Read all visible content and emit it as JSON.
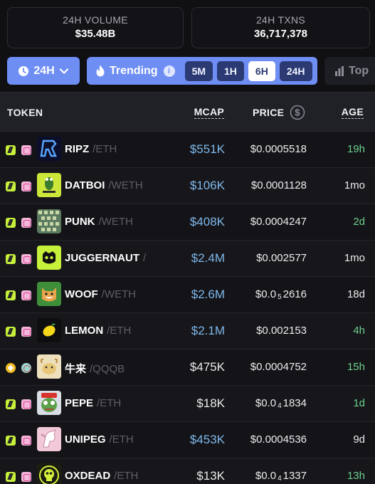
{
  "stats": {
    "volume": {
      "label": "24H VOLUME",
      "value": "$35.48B"
    },
    "txns": {
      "label": "24H TXNS",
      "value": "36,717,378"
    }
  },
  "filters": {
    "period": "24H",
    "trending_label": "Trending",
    "timeframes": [
      {
        "label": "5M",
        "active": false
      },
      {
        "label": "1H",
        "active": false
      },
      {
        "label": "6H",
        "active": true
      },
      {
        "label": "24H",
        "active": false
      }
    ],
    "top_label": "Top"
  },
  "table": {
    "headers": {
      "token": "TOKEN",
      "mcap": "MCAP",
      "price": "PRICE",
      "age": "AGE"
    },
    "rows": [
      {
        "symbol": "RIPZ",
        "pair": "/ETH",
        "mcap": "$551K",
        "price": "$0.0005518",
        "price_sub": "",
        "price_tail": "",
        "age": "19h",
        "age_green": true,
        "mcap_blue": true
      },
      {
        "symbol": "DATBOI",
        "pair": "/WETH",
        "mcap": "$106K",
        "price": "$0.0001128",
        "price_sub": "",
        "price_tail": "",
        "age": "1mo",
        "age_green": false,
        "mcap_blue": true
      },
      {
        "symbol": "PUNK",
        "pair": "/WETH",
        "mcap": "$408K",
        "price": "$0.0004247",
        "price_sub": "",
        "price_tail": "",
        "age": "2d",
        "age_green": true,
        "mcap_blue": true
      },
      {
        "symbol": "JUGGERNAUT",
        "pair": "/",
        "mcap": "$2.4M",
        "price": "$0.002577",
        "price_sub": "",
        "price_tail": "",
        "age": "1mo",
        "age_green": false,
        "mcap_blue": true
      },
      {
        "symbol": "WOOF",
        "pair": "/WETH",
        "mcap": "$2.6M",
        "price": "$0.0",
        "price_sub": "5",
        "price_tail": "2616",
        "age": "18d",
        "age_green": false,
        "mcap_blue": true
      },
      {
        "symbol": "LEMON",
        "pair": "/ETH",
        "mcap": "$2.1M",
        "price": "$0.002153",
        "price_sub": "",
        "price_tail": "",
        "age": "4h",
        "age_green": true,
        "mcap_blue": true
      },
      {
        "symbol": "牛来",
        "pair": "/QQQB",
        "mcap": "$475K",
        "price": "$0.0004752",
        "price_sub": "",
        "price_tail": "",
        "age": "15h",
        "age_green": true,
        "mcap_blue": false
      },
      {
        "symbol": "PEPE",
        "pair": "/ETH",
        "mcap": "$18K",
        "price": "$0.0",
        "price_sub": "4",
        "price_tail": "1834",
        "age": "1d",
        "age_green": true,
        "mcap_blue": false
      },
      {
        "symbol": "UNIPEG",
        "pair": "/ETH",
        "mcap": "$453K",
        "price": "$0.0004536",
        "price_sub": "",
        "price_tail": "",
        "age": "9d",
        "age_green": false,
        "mcap_blue": true
      },
      {
        "symbol": "OXDEAD",
        "pair": "/ETH",
        "mcap": "$13K",
        "price": "$0.0",
        "price_sub": "4",
        "price_tail": "1337",
        "age": "13h",
        "age_green": true,
        "mcap_blue": false
      }
    ]
  },
  "icons": {
    "clock": "clock-icon",
    "chevron": "chevron-down-icon",
    "flame": "flame-icon",
    "info": "info-icon",
    "bars": "bar-chart-icon",
    "dollar": "dollar-circle-icon"
  },
  "colors": {
    "accent": "#6e8ef4",
    "mcap_blue": "#7fb8ec",
    "age_green": "#6cd08c",
    "background": "#101013"
  }
}
